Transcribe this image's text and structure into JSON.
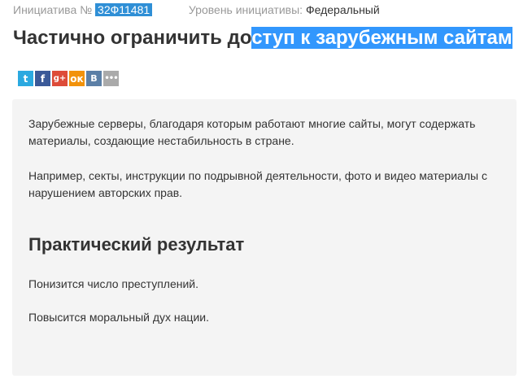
{
  "meta": {
    "initiative_label": "Инициатива №",
    "initiative_number": "32Ф11481",
    "level_label": "Уровень инициативы:",
    "level_value": "Федеральный"
  },
  "title": {
    "unselected": "Частично ограничить до",
    "selected": "ступ к зарубежным сайтам"
  },
  "share": {
    "twitter": "t",
    "facebook": "f",
    "googleplus": "g+",
    "odnoklassniki": "ок",
    "vkontakte": "В",
    "more": "•••"
  },
  "content": {
    "paragraph_1": "Зарубежные серверы, благодаря которым работают многие сайты, могут содержать материалы, создающие нестабильность в стране.",
    "paragraph_2": "Например, секты, инструкции по подрывной деятельности, фото и видео материалы с нарушением авторских прав.",
    "result_heading": "Практический результат",
    "result_1": "Понизится число преступлений.",
    "result_2": "Повысится моральный дух нации."
  },
  "colors": {
    "highlight": "#3297fd",
    "number_badge": "#2f8fd6",
    "card_background": "#f4f4f4"
  }
}
